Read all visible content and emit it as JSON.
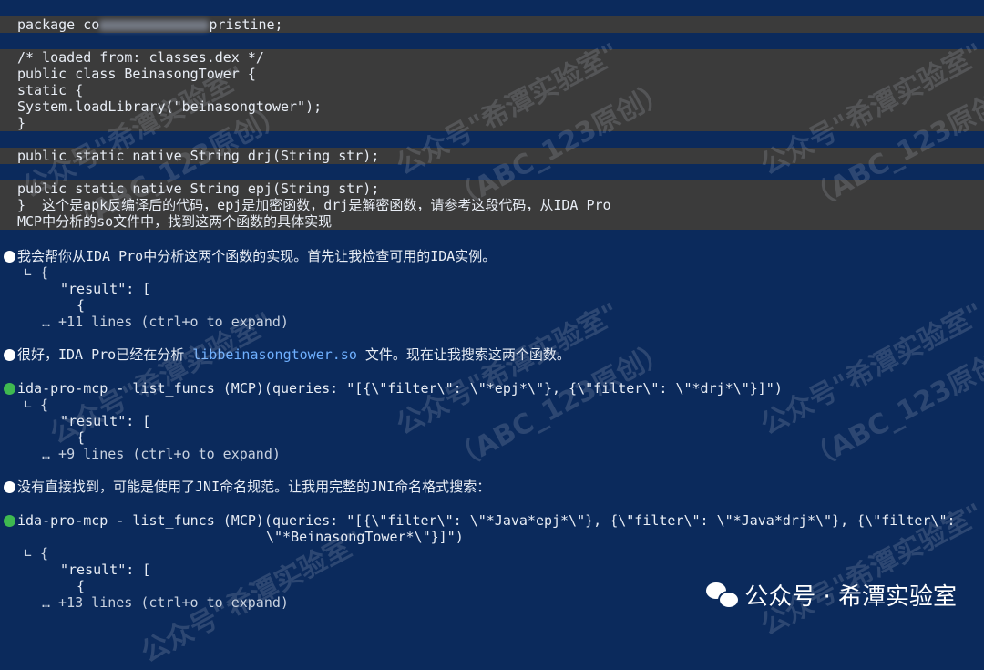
{
  "code": {
    "package_prefix": "package co",
    "package_suffix": "pristine;",
    "comment": "/* loaded from: classes.dex */",
    "class_decl": "public class BeinasongTower {",
    "static_open": "static {",
    "load_library": "System.loadLibrary(\"beinasongtower\");",
    "close_brace": "}",
    "drj_decl": "public static native String drj(String str);",
    "epj_decl": "public static native String epj(String str);",
    "prompt_line1": "}  这个是apk反编译后的代码，epj是加密函数，drj是解密函数，请参考这段代码，从IDA Pro",
    "prompt_line2": "MCP中分析的so文件中，找到这两个函数的具体实现"
  },
  "messages": {
    "m1": "我会帮你从IDA Pro中分析这两个函数的实现。首先让我检查可用的IDA实例。",
    "m1_r1": "∟ {",
    "m1_r2": "\"result\": [",
    "m1_r3": "{",
    "m1_r4": "… +11 lines (ctrl+o to expand)",
    "m2_prefix": "很好，IDA Pro已经在分析 ",
    "m2_file": "libbeinasongtower.so",
    "m2_suffix": " 文件。现在让我搜索这两个函数。",
    "t1": "ida-pro-mcp - list_funcs (MCP)(queries: \"[{\\\"filter\\\": \\\"*epj*\\\"}, {\\\"filter\\\": \\\"*drj*\\\"}]\")",
    "t1_r1": "∟ {",
    "t1_r2": "\"result\": [",
    "t1_r3": "{",
    "t1_r4": "… +9 lines (ctrl+o to expand)",
    "m3": "没有直接找到，可能是使用了JNI命名规范。让我用完整的JNI命名格式搜索：",
    "t2_line1": "ida-pro-mcp - list_funcs (MCP)(queries: \"[{\\\"filter\\\": \\\"*Java*epj*\\\"}, {\\\"filter\\\": \\\"*Java*drj*\\\"}, {\\\"filter\\\":",
    "t2_line2": "\\\"*BeinasongTower*\\\"}]\")",
    "t2_r1": "∟ {",
    "t2_r2": "\"result\": [",
    "t2_r3": "{",
    "t2_r4": "… +13 lines (ctrl+o to expand)"
  },
  "watermark": {
    "text1": "公众号\"希潭实验室\"",
    "text2": "（ABC_123原创）"
  },
  "brand": {
    "label": "公众号 · 希潭实验室"
  },
  "colors": {
    "background": "#0b2a5c",
    "highlight": "#3b3b3b",
    "tool_bullet": "#3fb950",
    "file_link": "#6fb0ff"
  }
}
